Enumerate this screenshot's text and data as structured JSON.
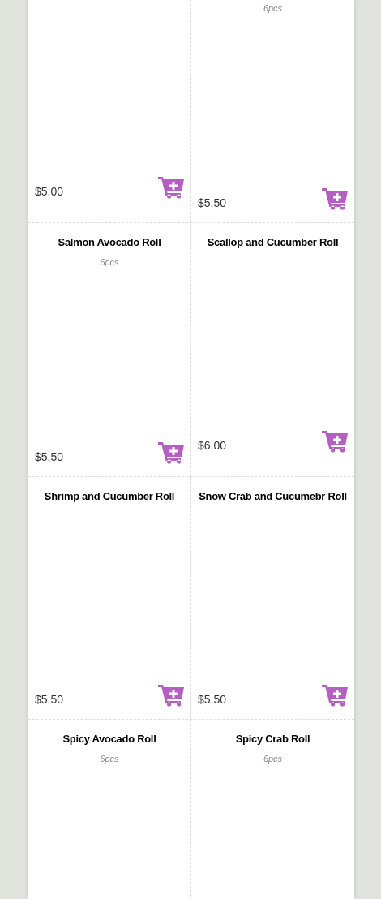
{
  "rows": [
    {
      "items": [
        {
          "price": "$5.00"
        },
        {
          "pcs": "6pcs",
          "price": "$5.50"
        }
      ]
    },
    {
      "items": [
        {
          "name": "Salmon Avocado Roll",
          "pcs": "6pcs",
          "price": "$5.50"
        },
        {
          "name": "Scallop and Cucumber Roll",
          "price": "$6.00"
        }
      ]
    },
    {
      "items": [
        {
          "name": "Shrimp and Cucumber Roll",
          "price": "$5.50"
        },
        {
          "name": "Snow Crab and Cucumebr Roll",
          "price": "$5.50"
        }
      ]
    },
    {
      "items": [
        {
          "name": "Spicy Avocado Roll",
          "pcs": "6pcs"
        },
        {
          "name": "Spicy Crab Roll",
          "pcs": "6pcs"
        }
      ]
    }
  ]
}
